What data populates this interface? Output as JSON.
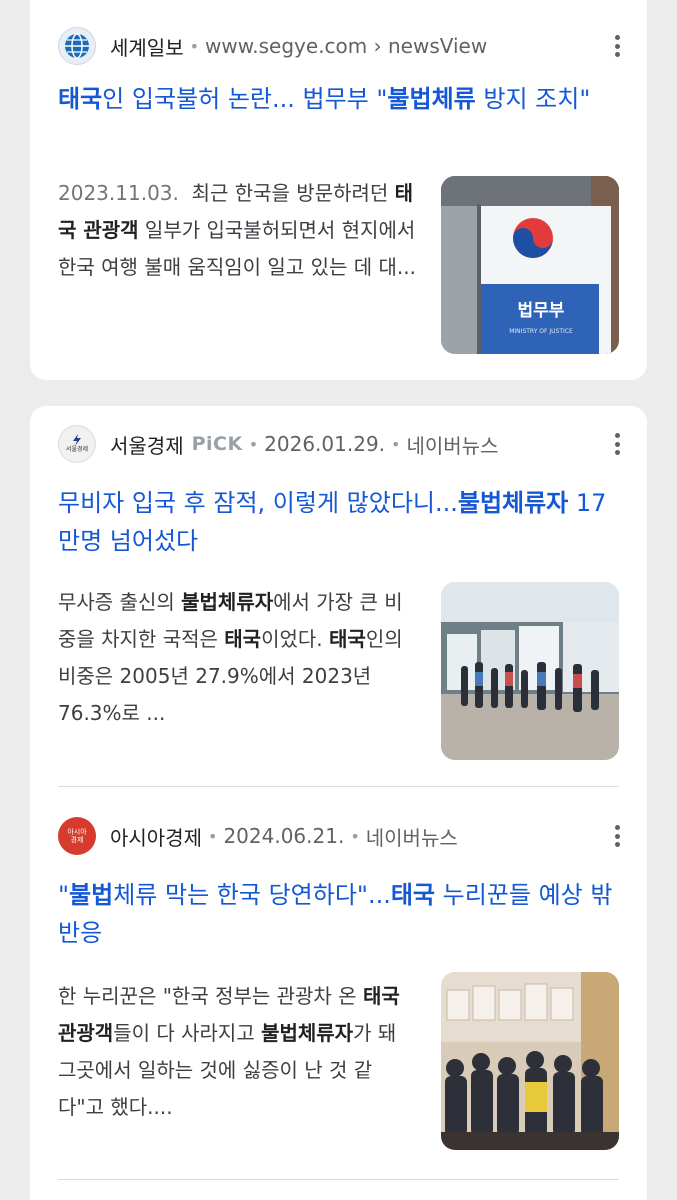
{
  "results": [
    {
      "source_name": "세계일보",
      "source_url": "www.segye.com › newsView",
      "title_parts": [
        {
          "text": "태국",
          "bold": true
        },
        {
          "text": "인 입국불허 논란... 법무부 \"",
          "bold": false
        },
        {
          "text": "불법체류",
          "bold": true
        },
        {
          "text": " 방지 조치\"",
          "bold": false
        }
      ],
      "date": "2023.11.03.",
      "snippet_parts": [
        {
          "text": "최근 한국을 방문하려던 ",
          "bold": false
        },
        {
          "text": "태국 관광객",
          "bold": true
        },
        {
          "text": " 일부가 입국불허되면서 현지에서 한국 여행 불매 움직임이 일고 있는 데 대...",
          "bold": false
        }
      ],
      "thumb_text": "법무부",
      "thumb_subtext": "MINISTRY OF JUSTICE",
      "icon": "globe-logo-icon"
    },
    {
      "source_name": "서울경제",
      "pick_label": "PiCK",
      "date_meta": "2026.01.29.",
      "platform": "네이버뉴스",
      "logo_text": "서울경제",
      "title_parts": [
        {
          "text": "무비자 입국 후 잠적, 이렇게 많았다니...",
          "bold": false
        },
        {
          "text": "불법체류자",
          "bold": true
        },
        {
          "text": " 17만명 넘어섰다",
          "bold": false
        }
      ],
      "snippet_parts": [
        {
          "text": "무사증 출신의 ",
          "bold": false
        },
        {
          "text": "불법체류자",
          "bold": true
        },
        {
          "text": "에서 가장 큰 비중을 차지한 국적은 ",
          "bold": false
        },
        {
          "text": "태국",
          "bold": true
        },
        {
          "text": "이었다. ",
          "bold": false
        },
        {
          "text": "태국",
          "bold": true
        },
        {
          "text": "인의 비중은 2005년 27.9%에서 2023년 76.3%로 ...",
          "bold": false
        }
      ],
      "icon": "seoul-economy-logo-icon"
    },
    {
      "source_name": "아시아경제",
      "date_meta": "2024.06.21.",
      "platform": "네이버뉴스",
      "logo_text": "아시아\n경제",
      "title_parts": [
        {
          "text": "\"",
          "bold": false
        },
        {
          "text": "불법",
          "bold": true
        },
        {
          "text": "체류 막는 한국 당연하다\"...",
          "bold": false
        },
        {
          "text": "태국",
          "bold": true
        },
        {
          "text": " 누리꾼들 예상 밖 반응",
          "bold": false
        }
      ],
      "snippet_parts": [
        {
          "text": "한 누리꾼은 \"한국 정부는 관광차 온 ",
          "bold": false
        },
        {
          "text": "태국 관광객",
          "bold": true
        },
        {
          "text": "들이 다 사라지고 ",
          "bold": false
        },
        {
          "text": "불법체류자",
          "bold": true
        },
        {
          "text": "가 돼 그곳에서 일하는 것에 싫증이 난 것 같다\"고 했다....",
          "bold": false
        }
      ],
      "icon": "asia-economy-logo-icon"
    }
  ],
  "colors": {
    "title_link": "#1558d6",
    "meta_gray": "#5f6368",
    "background": "#ececec"
  }
}
